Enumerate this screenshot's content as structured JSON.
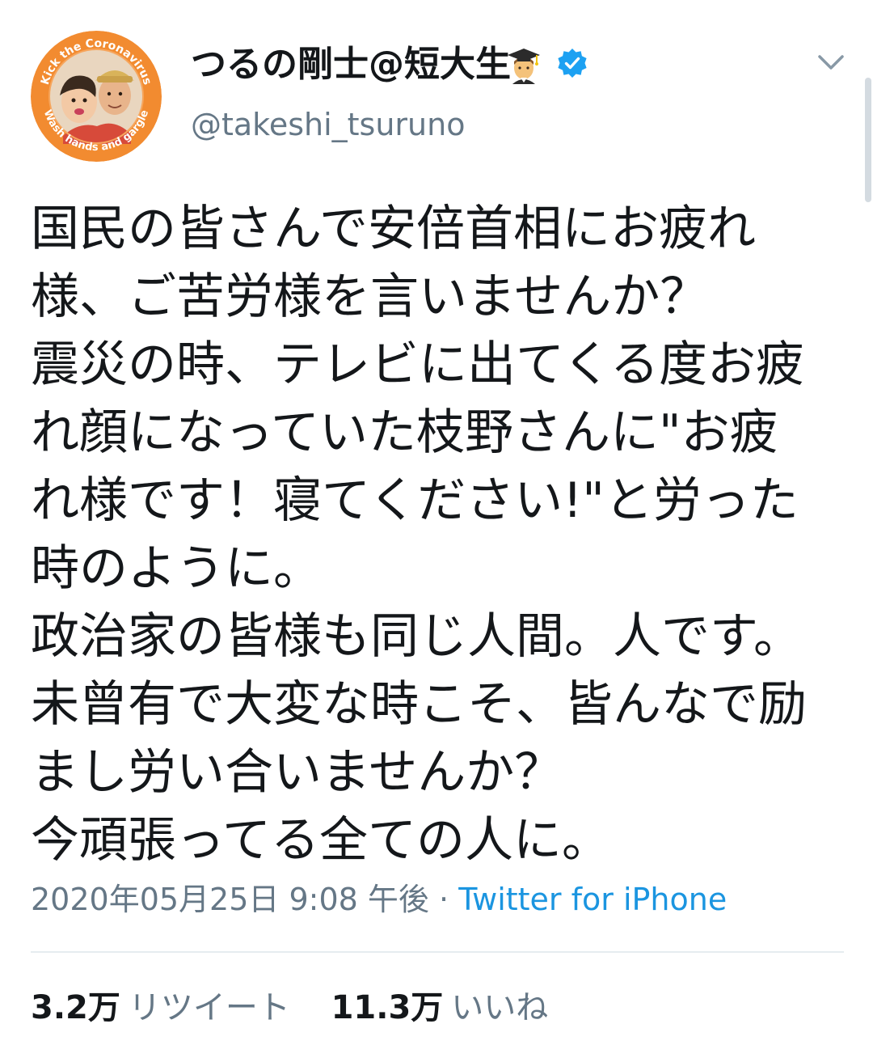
{
  "user": {
    "display_name": "つるの剛士@短大生",
    "handle": "@takeshi_tsuruno",
    "name_emoji": "graduation-cap-man-emoji",
    "verified_icon": "verified-badge-icon",
    "avatar_ring_text_top": "Kick the Coronavirus",
    "avatar_ring_text_bottom": "Wash hands and gargle"
  },
  "tweet": {
    "lines": [
      "国民の皆さんで安倍首相にお疲れ",
      "様、ご苦労様を言いませんか？",
      "震災の時、テレビに出てくる度お疲",
      "れ顔になっていた枝野さんに\"お疲",
      "れ様です！寝てください!\"と労った",
      "時のように。",
      "政治家の皆様も同じ人間。人です。",
      "未曾有で大変な時こそ、皆んなで励",
      "まし労い合いませんか？",
      "今頑張ってる全ての人に。"
    ],
    "date": "2020年05月25日 9:08 午後",
    "separator": "·",
    "source": "Twitter for iPhone"
  },
  "stats": {
    "retweets_count": "3.2万",
    "retweets_label": "リツイート",
    "likes_count": "11.3万",
    "likes_label": "いいね"
  },
  "colors": {
    "text_primary": "#14171a",
    "text_secondary": "#657786",
    "link": "#1b95e0",
    "verified": "#1da1f2",
    "avatar_ring": "#f28b30",
    "divider": "#e6ecf0"
  }
}
